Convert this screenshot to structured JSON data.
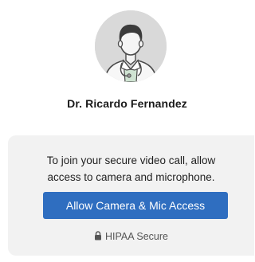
{
  "doctor": {
    "name": "Dr. Ricardo Fernandez",
    "avatar_icon": "doctor-avatar-icon"
  },
  "permission_card": {
    "message_line1": "To join your secure video call, allow",
    "message_line2": "access to camera and microphone.",
    "button_label": "Allow Camera & Mic Access",
    "security_label": "HIPAA Secure",
    "security_icon": "lock-icon"
  },
  "colors": {
    "button_background": "#2f6ec0",
    "card_background": "#f2f2f2",
    "avatar_background": "#d9d9d9"
  }
}
